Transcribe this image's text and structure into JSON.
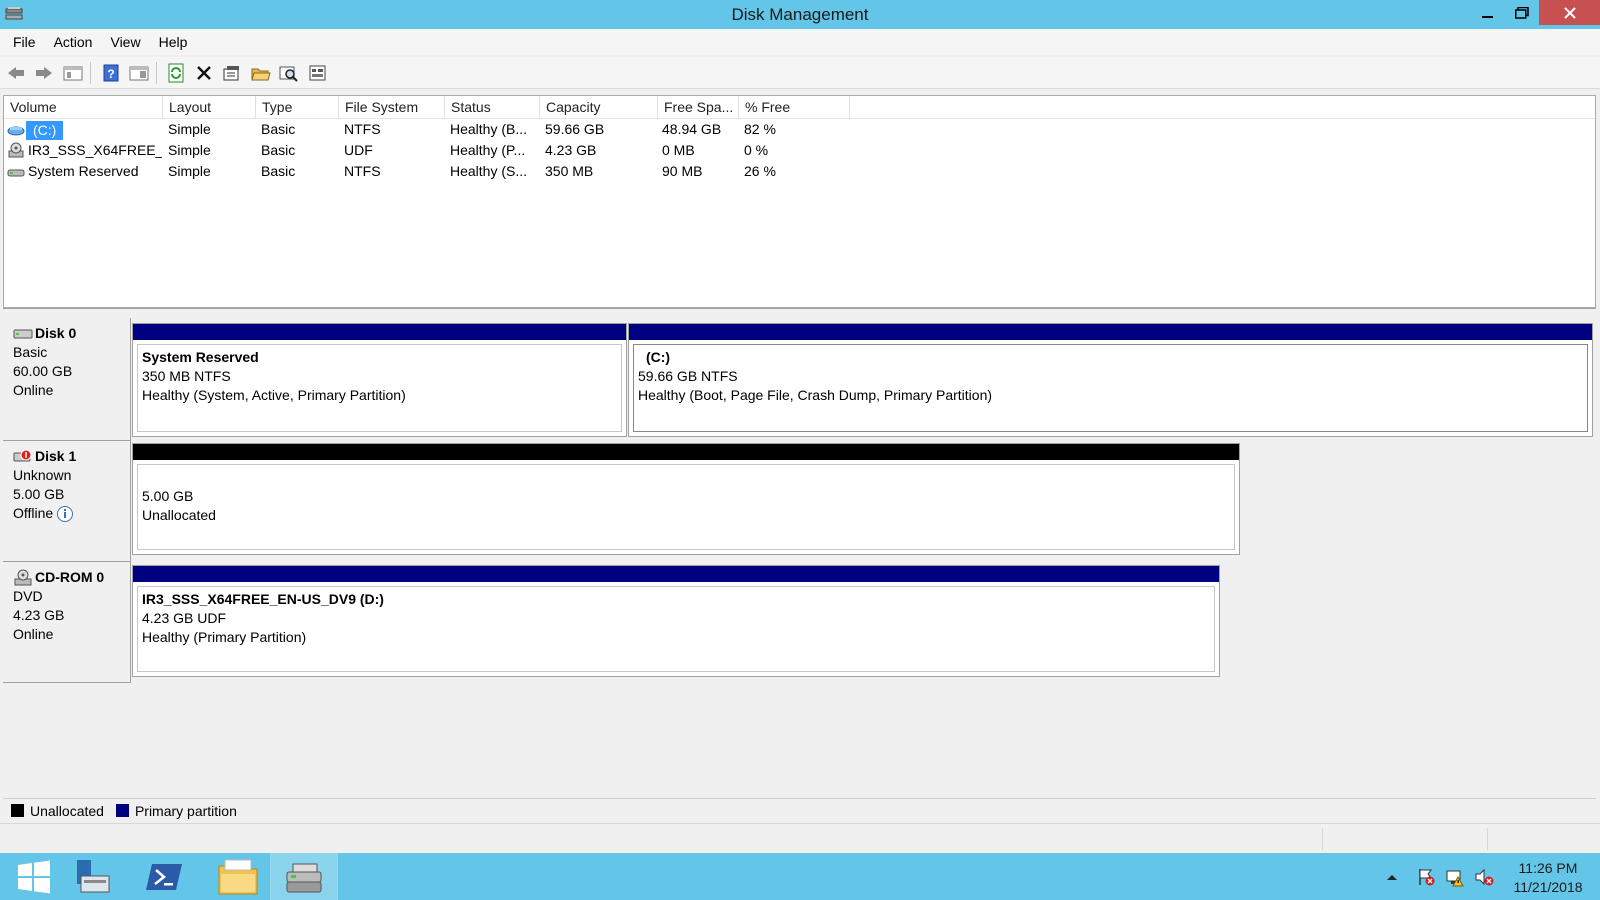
{
  "window": {
    "title": "Disk Management"
  },
  "menu": [
    "File",
    "Action",
    "View",
    "Help"
  ],
  "toolbar": {
    "icons": [
      "back-icon",
      "forward-icon",
      "console-tree-icon",
      "help-icon",
      "show-pane-icon",
      "refresh-icon",
      "delete-icon",
      "properties-icon",
      "open-icon",
      "explore-icon",
      "settings-icon"
    ]
  },
  "volumes": {
    "columns": [
      "Volume",
      "Layout",
      "Type",
      "File System",
      "Status",
      "Capacity",
      "Free Spa...",
      "% Free"
    ],
    "rows": [
      {
        "volume": "(C:)",
        "layout": "Simple",
        "type": "Basic",
        "fs": "NTFS",
        "status": "Healthy (B...",
        "capacity": "59.66 GB",
        "free": "48.94 GB",
        "pct": "82 %"
      },
      {
        "volume": "IR3_SSS_X64FREE_...",
        "layout": "Simple",
        "type": "Basic",
        "fs": "UDF",
        "status": "Healthy (P...",
        "capacity": "4.23 GB",
        "free": "0 MB",
        "pct": "0 %"
      },
      {
        "volume": "System Reserved",
        "layout": "Simple",
        "type": "Basic",
        "fs": "NTFS",
        "status": "Healthy (S...",
        "capacity": "350 MB",
        "free": "90 MB",
        "pct": "26 %"
      }
    ]
  },
  "disks": [
    {
      "name": "Disk 0",
      "type": "Basic",
      "size": "60.00 GB",
      "state": "Online",
      "partitions": [
        {
          "title": "System Reserved",
          "size": "350 MB NTFS",
          "status": "Healthy (System, Active, Primary Partition)"
        },
        {
          "title": "(C:)",
          "size": "59.66 GB NTFS",
          "status": "Healthy (Boot, Page File, Crash Dump, Primary Partition)"
        }
      ]
    },
    {
      "name": "Disk 1",
      "type": "Unknown",
      "size": "5.00 GB",
      "state": "Offline",
      "partitions": [
        {
          "size": "5.00 GB",
          "status": "Unallocated"
        }
      ]
    },
    {
      "name": "CD-ROM 0",
      "type": "DVD",
      "size": "4.23 GB",
      "state": "Online",
      "partitions": [
        {
          "title": "IR3_SSS_X64FREE_EN-US_DV9  (D:)",
          "size": "4.23 GB UDF",
          "status": "Healthy (Primary Partition)"
        }
      ]
    }
  ],
  "legend": [
    {
      "label": "Unallocated",
      "color": "#000000"
    },
    {
      "label": "Primary partition",
      "color": "#000080"
    }
  ],
  "colors": {
    "primary": "#000080",
    "unallocated": "#000000",
    "selection": "#3399ff",
    "titlebar": "#63c6e8"
  },
  "taskbar": {
    "time": "11:26 PM",
    "date": "11/21/2018"
  }
}
